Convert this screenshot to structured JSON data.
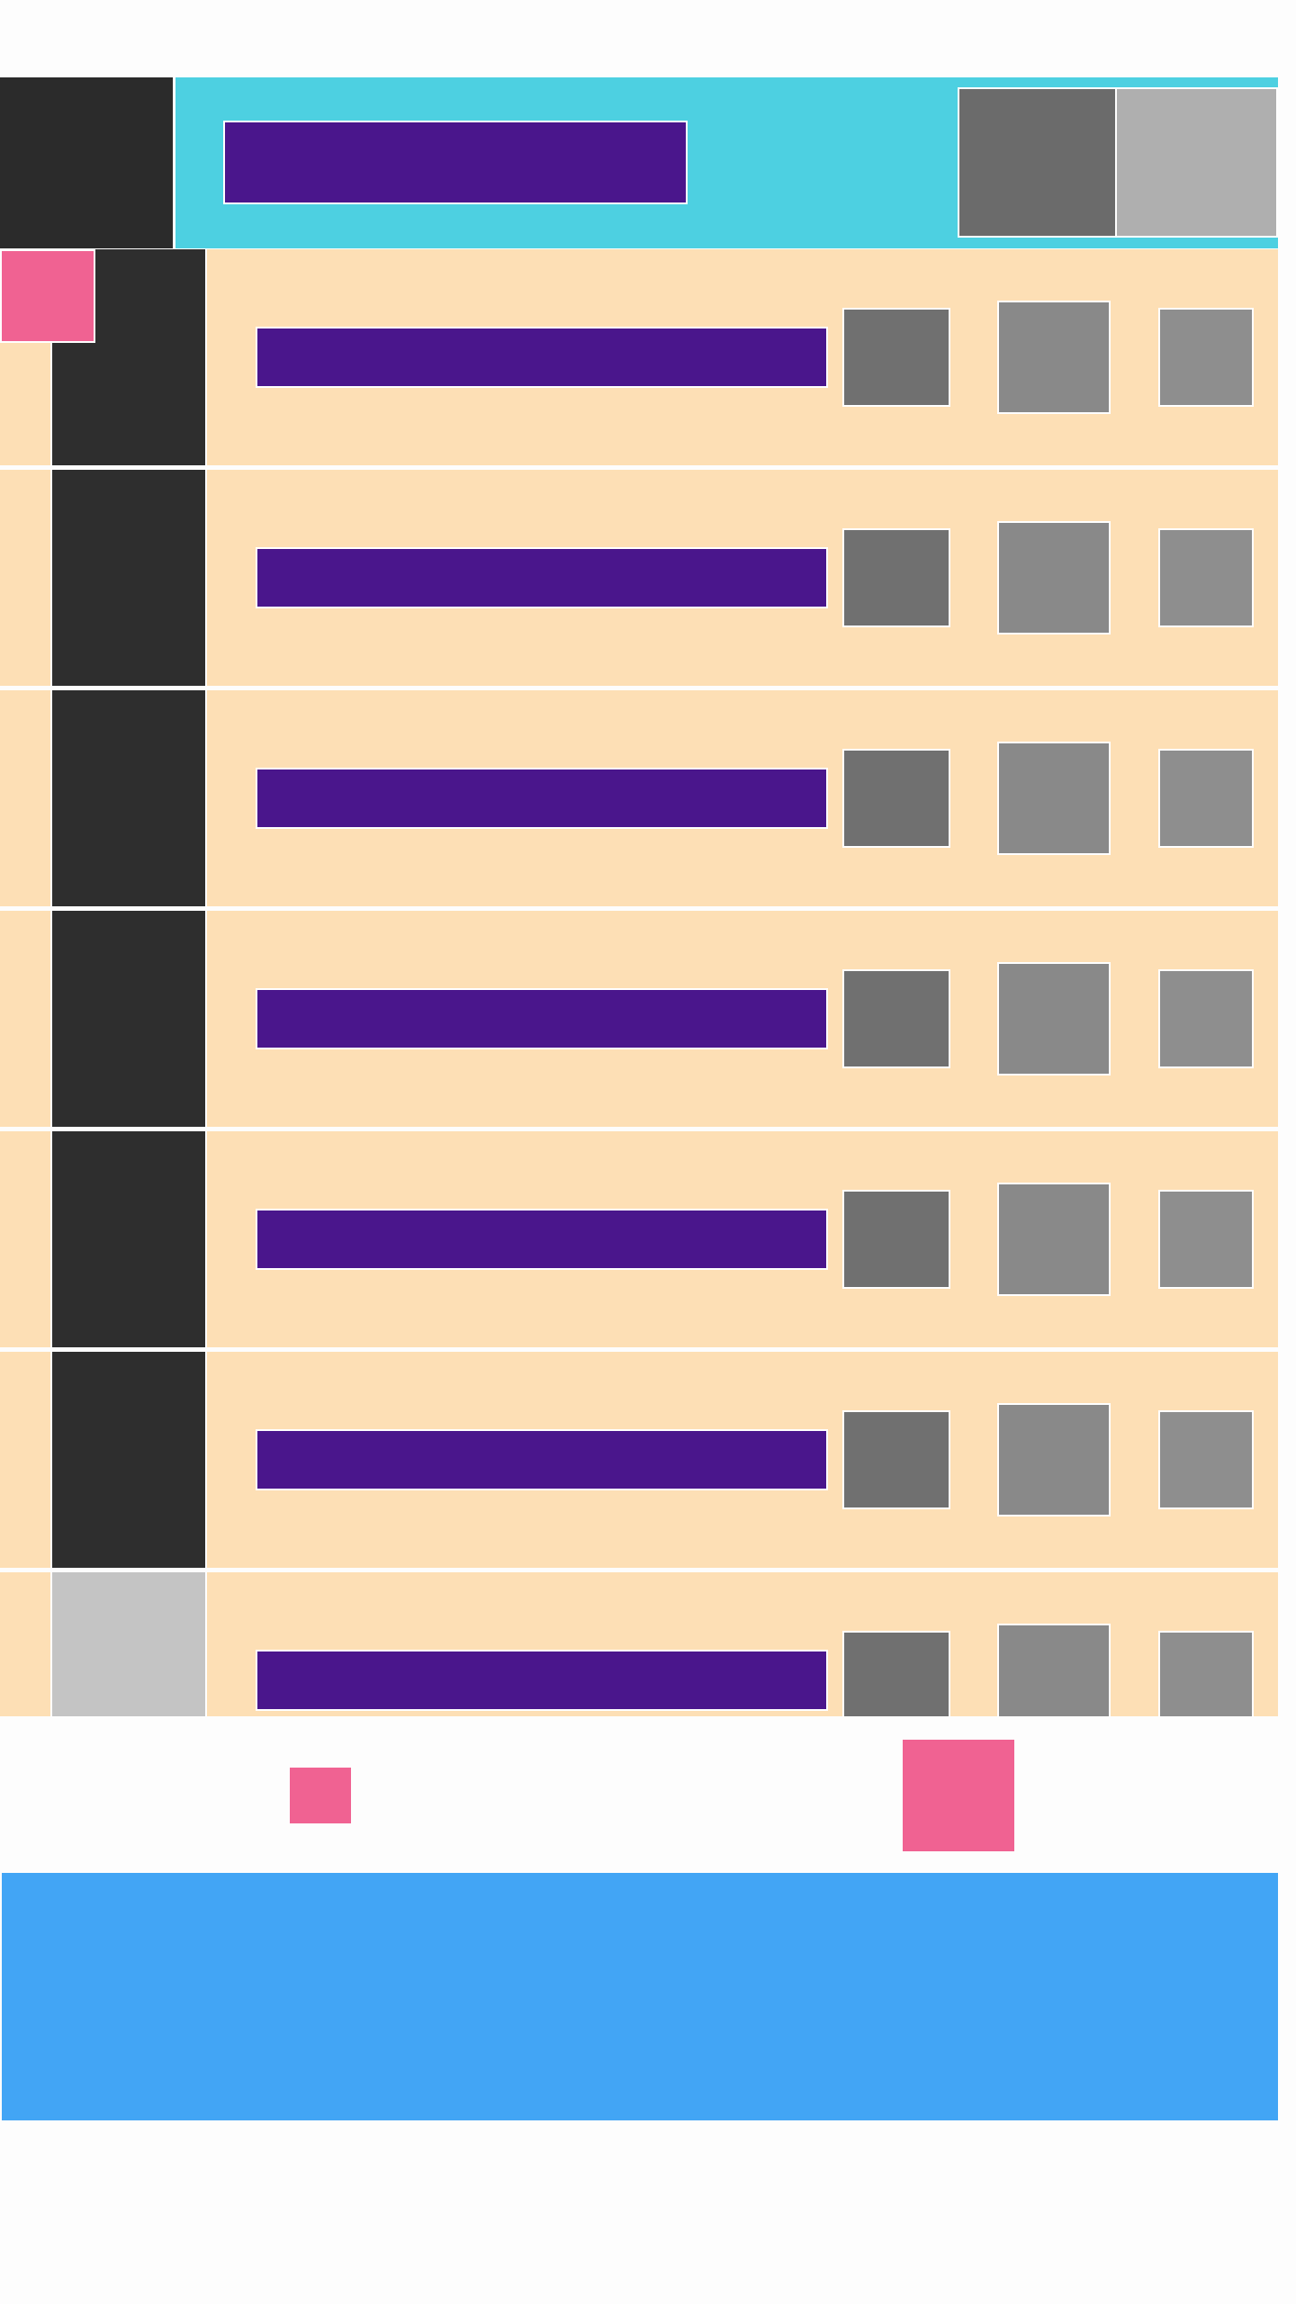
{
  "app": {
    "header": {
      "title": "",
      "primary_action_icon": "square-icon",
      "secondary_action_icon": "square-icon"
    },
    "list": {
      "items": [
        {
          "title": "",
          "thumbnail": "dark"
        },
        {
          "title": "",
          "thumbnail": "dark"
        },
        {
          "title": "",
          "thumbnail": "dark"
        },
        {
          "title": "",
          "thumbnail": "dark"
        },
        {
          "title": "",
          "thumbnail": "dark"
        },
        {
          "title": "",
          "thumbnail": "dark"
        },
        {
          "title": "",
          "thumbnail": "light"
        }
      ]
    },
    "pager": {
      "indicator_icon": "dot-icon",
      "fab_icon": "square-icon"
    },
    "banner": {
      "text": ""
    }
  },
  "colors": {
    "header_bg": "#4dd0e1",
    "header_left": "#2b2b2b",
    "title_bg": "#4a168c",
    "item_bg": "#fddfb5",
    "thumb_dark": "#2e2e2e",
    "thumb_light": "#c4c4c4",
    "accent_pink": "#f06292",
    "banner_bg": "#42a5f5",
    "page_bg": "#fdfdfd"
  }
}
